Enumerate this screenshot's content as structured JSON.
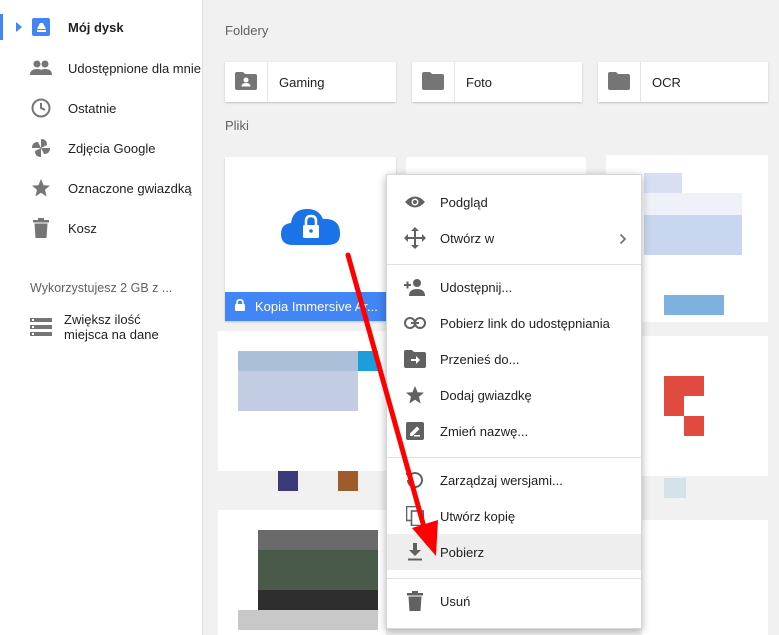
{
  "sidebar": {
    "items": [
      {
        "label": "Mój dysk",
        "icon": "drive-icon"
      },
      {
        "label": "Udostępnione dla mnie",
        "icon": "shared-people-icon"
      },
      {
        "label": "Ostatnie",
        "icon": "clock-icon"
      },
      {
        "label": "Zdjęcia Google",
        "icon": "pinwheel-icon"
      },
      {
        "label": "Oznaczone gwiazdką",
        "icon": "star-icon"
      },
      {
        "label": "Kosz",
        "icon": "trash-icon"
      }
    ],
    "storage_text": "Wykorzystujesz 2 GB z ...",
    "upgrade_label_line1": "Zwiększ ilość",
    "upgrade_label_line2": "miejsca na dane"
  },
  "main": {
    "folders_title": "Foldery",
    "files_title": "Pliki",
    "folders": [
      {
        "label": "Gaming",
        "icon": "shared-folder-icon"
      },
      {
        "label": "Foto",
        "icon": "folder-icon"
      },
      {
        "label": "OCR",
        "icon": "folder-icon"
      }
    ],
    "selected_file": {
      "name": "Kopia Immersive Ar..."
    }
  },
  "context_menu": {
    "items": [
      {
        "label": "Podgląd",
        "icon": "eye-icon"
      },
      {
        "label": "Otwórz w",
        "icon": "move-arrows-icon"
      },
      {
        "label": "Udostępnij...",
        "icon": "add-person-icon"
      },
      {
        "label": "Pobierz link do udostępniania",
        "icon": "link-icon"
      },
      {
        "label": "Przenieś do...",
        "icon": "move-folder-icon"
      },
      {
        "label": "Dodaj gwiazdkę",
        "icon": "star-icon"
      },
      {
        "label": "Zmień nazwę...",
        "icon": "rename-icon"
      },
      {
        "label": "Zarządzaj wersjami...",
        "icon": "history-icon"
      },
      {
        "label": "Utwórz kopię",
        "icon": "copy-icon"
      },
      {
        "label": "Pobierz",
        "icon": "download-icon"
      },
      {
        "label": "Usuń",
        "icon": "delete-icon"
      }
    ],
    "highlighted": "Pobierz"
  },
  "colors": {
    "accent": "#4285f4",
    "annotation_arrow": "#ff0000"
  }
}
